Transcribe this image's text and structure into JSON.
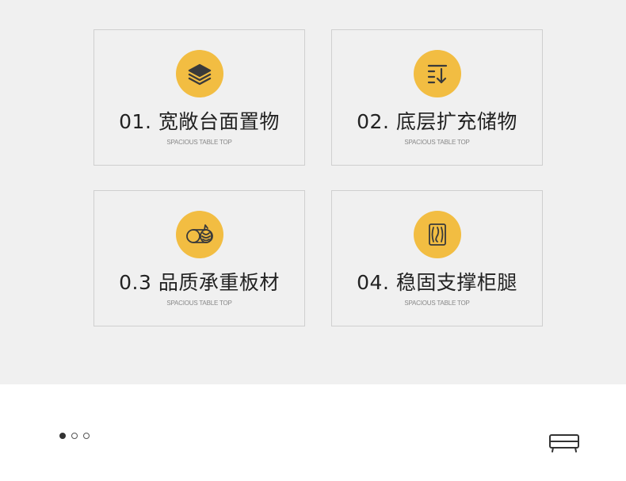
{
  "features": [
    {
      "title": "01. 宽敞台面置物",
      "subtitle": "SPACIOUS TABLE TOP",
      "icon": "stack-layers-icon"
    },
    {
      "title": "02. 底层扩充储物",
      "subtitle": "SPACIOUS TABLE TOP",
      "icon": "sort-down-icon"
    },
    {
      "title": "0.3 品质承重板材",
      "subtitle": "SPACIOUS TABLE TOP",
      "icon": "wood-log-icon"
    },
    {
      "title": "04. 稳固支撑柜腿",
      "subtitle": "SPACIOUS TABLE TOP",
      "icon": "wood-grain-icon"
    }
  ],
  "carousel": {
    "count": 3,
    "active_index": 0
  },
  "colors": {
    "accent": "#f2bd42",
    "icon_stroke": "#3a3a3a",
    "panel_bg": "#f0f0f0",
    "text": "#222222"
  },
  "footer_icon": "tv-cabinet-icon"
}
